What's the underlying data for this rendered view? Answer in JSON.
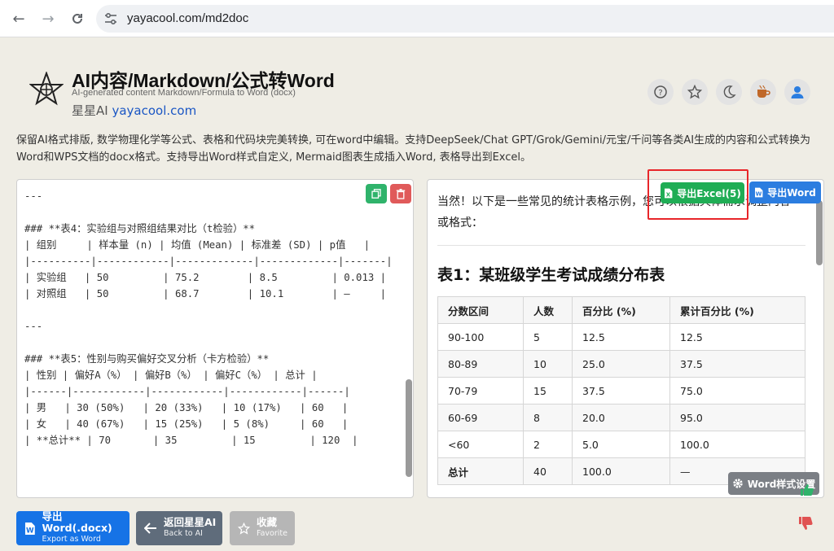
{
  "browser": {
    "url": "yayacool.com/md2doc"
  },
  "header": {
    "title": "AI内容/Markdown/公式转Word",
    "subtitle": "AI-generated content Markdown/Formula to Word (docx)",
    "brand_prefix": "星星AI",
    "brand_link": "yayacool.com"
  },
  "description": "保留AI格式排版, 数学物理化学等公式、表格和代码块完美转换, 可在word中编辑。支持DeepSeek/Chat GPT/Grok/Gemini/元宝/千问等各类AI生成的内容和公式转换为Word和WPS文档的docx格式。支持导出Word样式自定义, Mermaid图表生成插入Word, 表格导出到Excel。",
  "editor": {
    "content": "---\n\n### **表4：实验组与对照组结果对比（t检验）**\n| 组别     | 样本量 (n) | 均值 (Mean) | 标准差 (SD) | p值   |\n|----------|------------|-------------|-------------|-------|\n| 实验组   | 50         | 75.2        | 8.5         | 0.013 |\n| 对照组   | 50         | 68.7        | 10.1        | –     |\n\n---\n\n### **表5：性别与购买偏好交叉分析（卡方检验）**\n| 性别 | 偏好A（%） | 偏好B（%） | 偏好C（%） | 总计 |\n|------|------------|------------|------------|------|\n| 男   | 30 (50%)   | 20 (33%)   | 10 (17%)   | 60   |\n| 女   | 40 (67%)   | 15 (25%)   | 5 (8%)     | 60   |\n| **总计** | 70       | 35         | 15         | 120  |"
  },
  "preview": {
    "intro": "当然！以下是一些常见的统计表格示例，您可以根据具体需求调整内容或格式：",
    "heading": "表1：某班级学生考试成绩分布表",
    "table": {
      "headers": [
        "分数区间",
        "人数",
        "百分比 (%)",
        "累计百分比 (%)"
      ],
      "rows": [
        [
          "90-100",
          "5",
          "12.5",
          "12.5"
        ],
        [
          "80-89",
          "10",
          "25.0",
          "37.5"
        ],
        [
          "70-79",
          "15",
          "37.5",
          "75.0"
        ],
        [
          "60-69",
          "8",
          "20.0",
          "95.0"
        ],
        [
          "<60",
          "2",
          "5.0",
          "100.0"
        ],
        [
          "总计",
          "40",
          "100.0",
          "—"
        ]
      ]
    },
    "export_excel_label": "导出Excel(5)",
    "export_word_label": "导出Word",
    "word_style_label": "Word样式设置"
  },
  "bottom": {
    "export_word_main": "导出Word(.docx)",
    "export_word_sub": "Export as Word",
    "back_main": "返回星星AI",
    "back_sub": "Back to AI",
    "fav_main": "收藏",
    "fav_sub": "Favorite"
  },
  "colors": {
    "excel_green": "#1fad55",
    "word_blue": "#1673e6",
    "highlight_red": "#e8262a",
    "background": "#efede5"
  }
}
